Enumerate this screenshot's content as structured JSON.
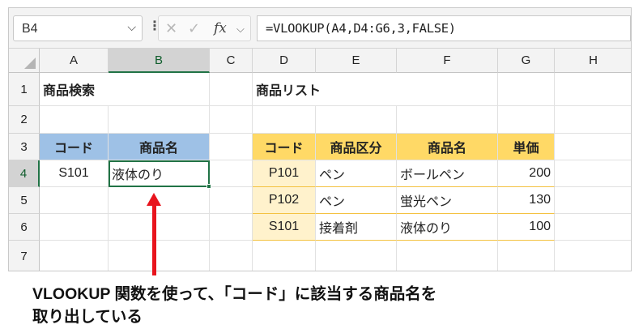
{
  "formula_bar": {
    "name_box": "B4",
    "name_box_dropdown": "⌵",
    "separator": "⋮",
    "cancel_glyph": "✕",
    "enter_glyph": "✓",
    "fx_label": "fx",
    "fx_dropdown": "⌵",
    "formula": "=VLOOKUP(A4,D4:G6,3,FALSE)"
  },
  "columns": [
    "A",
    "B",
    "C",
    "D",
    "E",
    "F",
    "G",
    "H"
  ],
  "rows": [
    "1",
    "2",
    "3",
    "4",
    "5",
    "6",
    "7"
  ],
  "selected_cell": "B4",
  "cells": {
    "A1": "商品検索",
    "D1": "商品リスト",
    "A3": "コード",
    "B3": "商品名",
    "A4": "S101",
    "B4": "液体のり",
    "D3": "コード",
    "E3": "商品区分",
    "F3": "商品名",
    "G3": "単価",
    "D4": "P101",
    "E4": "ペン",
    "F4": "ボールペン",
    "G4": "200",
    "D5": "P102",
    "E5": "ペン",
    "F5": "蛍光ペン",
    "G5": "130",
    "D6": "S101",
    "E6": "接着剤",
    "F6": "液体のり",
    "G6": "100"
  },
  "colors": {
    "search_header": "#9ec1e6",
    "list_header": "#ffd966",
    "list_band": "#fff2cc",
    "selection": "#217346",
    "arrow": "#e8141d"
  },
  "annotation": {
    "line1": "VLOOKUP 関数を使って、「コード」に該当する商品名を",
    "line2": "取り出している"
  }
}
